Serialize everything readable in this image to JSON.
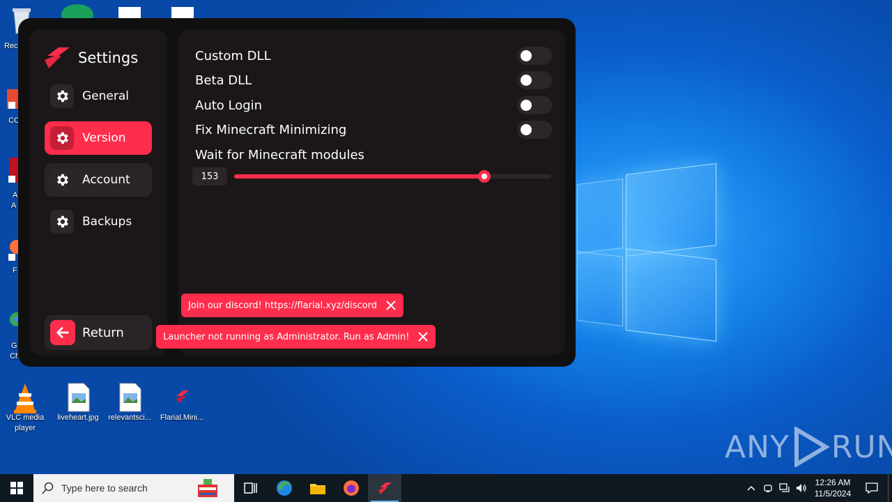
{
  "desktop": {
    "icons": [
      {
        "label": "VLC media player",
        "icon": "vlc-icon"
      },
      {
        "label": "liveheart.jpg",
        "icon": "image-file-icon"
      },
      {
        "label": "relevantsci...",
        "icon": "image-file-icon"
      },
      {
        "label": "Flarial.Mini...",
        "icon": "flarial-icon"
      }
    ],
    "partial_labels": [
      "Rec",
      "CC",
      "A",
      "A",
      "F",
      "G",
      "Ch"
    ],
    "watermark": "ANY RUN"
  },
  "launcher": {
    "title": "Settings",
    "nav": [
      {
        "label": "General",
        "icon": "gear-icon",
        "state": "normal"
      },
      {
        "label": "Version",
        "icon": "gear-icon",
        "state": "active"
      },
      {
        "label": "Account",
        "icon": "gear-icon",
        "state": "hover"
      },
      {
        "label": "Backups",
        "icon": "gear-icon",
        "state": "normal"
      }
    ],
    "return_label": "Return",
    "settings": [
      {
        "label": "Custom DLL",
        "enabled": false
      },
      {
        "label": "Beta DLL",
        "enabled": false
      },
      {
        "label": "Auto Login",
        "enabled": false
      },
      {
        "label": "Fix Minecraft Minimizing",
        "enabled": false
      }
    ],
    "slider": {
      "label": "Wait for Minecraft modules",
      "value": "153",
      "fraction": 0.79
    },
    "toasts": [
      {
        "text": "Join our discord! https://flarial.xyz/discord"
      },
      {
        "text": "Launcher not running as Administrator. Run as Admin!"
      }
    ],
    "colors": {
      "accent": "#ff2d4c",
      "panel": "#1b1718",
      "window": "#111010"
    }
  },
  "taskbar": {
    "search_placeholder": "Type here to search",
    "time": "12:26 AM",
    "date": "11/5/2024"
  }
}
